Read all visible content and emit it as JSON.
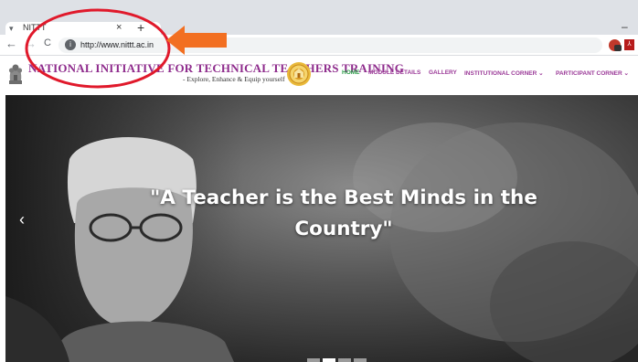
{
  "browser": {
    "tab_title": "NITTT",
    "tab_close": "×",
    "new_tab": "+",
    "minimize": "–",
    "back_icon": "←",
    "forward_icon": "→",
    "reload_icon": "C",
    "url": "http://www.nittt.ac.in"
  },
  "site": {
    "title": "NATIONAL INITIATIVE FOR TECHNICAL TEACHERS TRAINING",
    "tagline": "- Explore, Enhance & Equip yourself",
    "nav": {
      "home": "HOME",
      "module_details": "MODULE DETAILS",
      "gallery": "GALLERY",
      "institutional_corner": "INSTITUTIONAL CORNER ⌄",
      "participant_corner": "PARTICIPANT CORNER ⌄"
    }
  },
  "hero": {
    "quote": "\"A Teacher is the Best Minds in the Country\"",
    "prev_icon": "‹",
    "active_slide": 2,
    "slide_count": 4
  },
  "colors": {
    "brand": "#8e2b8c",
    "nav_active": "#2e9e4a",
    "annotation_red": "#e0192b",
    "annotation_arrow": "#f26f21"
  },
  "icons": {
    "emblem": "national-emblem-icon",
    "seal": "institute-seal-icon",
    "lock": "info-lock-icon"
  }
}
